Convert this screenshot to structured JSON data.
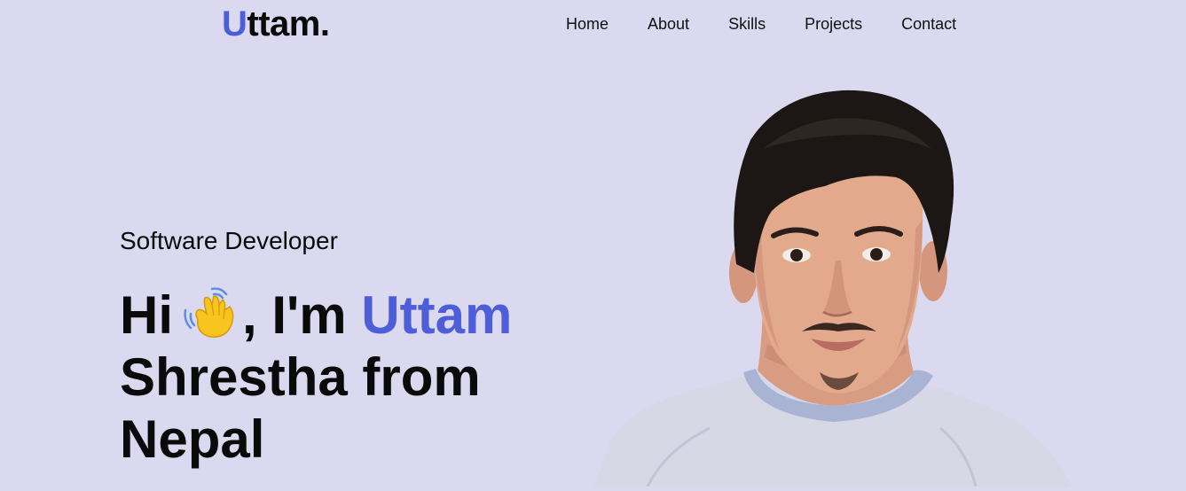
{
  "header": {
    "logo_first": "U",
    "logo_rest": "ttam."
  },
  "nav": {
    "items": [
      "Home",
      "About",
      "Skills",
      "Projects",
      "Contact"
    ]
  },
  "hero": {
    "subtitle": "Software Developer",
    "greeting": "Hi",
    "wave_icon": "waving-hand-icon",
    "intro_mid": ", I'm ",
    "name_highlight": "Uttam",
    "line2": "Shrestha from",
    "line3": "Nepal"
  },
  "portrait": {
    "icon": "profile-photo"
  },
  "colors": {
    "background": "#dad9f0",
    "accent": "#4d5ed8",
    "text": "#0a0a0a"
  }
}
